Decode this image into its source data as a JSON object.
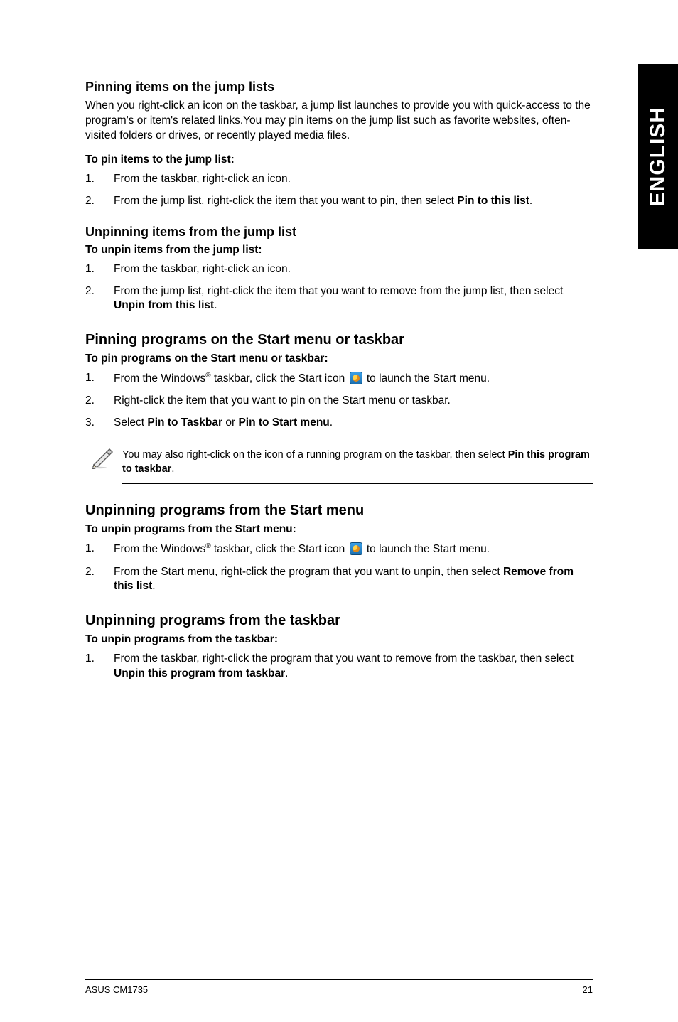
{
  "sideTab": "ENGLISH",
  "s1": {
    "heading": "Pinning items on the jump lists",
    "lead": "When you right-click an icon on the taskbar, a jump list launches to provide you with quick-access to the program's or item's related links.You may pin items on the jump list such as favorite websites, often-visited folders or drives, or recently played media files.",
    "sub": "To pin items to the jump list:",
    "i1": "From the taskbar, right-click an icon.",
    "i2a": "From the jump list, right-click the item that you want to pin, then select ",
    "i2b": "Pin to this list",
    "i2c": "."
  },
  "s2": {
    "heading": "Unpinning items from the jump list",
    "sub": "To unpin items from the jump list:",
    "i1": "From the taskbar, right-click an icon.",
    "i2a": "From the jump list, right-click the item that you want to remove from the jump list, then select ",
    "i2b": "Unpin from this list",
    "i2c": "."
  },
  "s3": {
    "heading": "Pinning programs on the Start menu or taskbar",
    "sub": "To pin programs on the Start menu or taskbar:",
    "i1a": "From the Windows",
    "i1b": " taskbar, click the Start icon ",
    "i1c": " to launch the Start menu.",
    "i2": "Right-click the item that you want to pin on the Start menu or taskbar.",
    "i3a": "Select ",
    "i3b": "Pin to Taskbar",
    "i3c": " or ",
    "i3d": "Pin to Start menu",
    "i3e": ".",
    "note_a": "You may also right-click on the icon of a running program on the taskbar, then select ",
    "note_b": "Pin this program to taskbar",
    "note_c": "."
  },
  "s4": {
    "heading": "Unpinning programs from the Start menu",
    "sub": "To unpin programs from the Start menu:",
    "i1a": "From the Windows",
    "i1b": " taskbar, click the Start icon ",
    "i1c": " to launch the Start menu.",
    "i2a": "From the Start menu, right-click the program that you want to unpin, then select ",
    "i2b": "Remove from this list",
    "i2c": "."
  },
  "s5": {
    "heading": "Unpinning programs from the taskbar",
    "sub": "To unpin programs from the taskbar:",
    "i1a": "From the taskbar, right-click the program that you want to remove from the taskbar, then select ",
    "i1b": "Unpin this program from taskbar",
    "i1c": "."
  },
  "footer": {
    "left": "ASUS CM1735",
    "right": "21"
  },
  "reg": "®"
}
